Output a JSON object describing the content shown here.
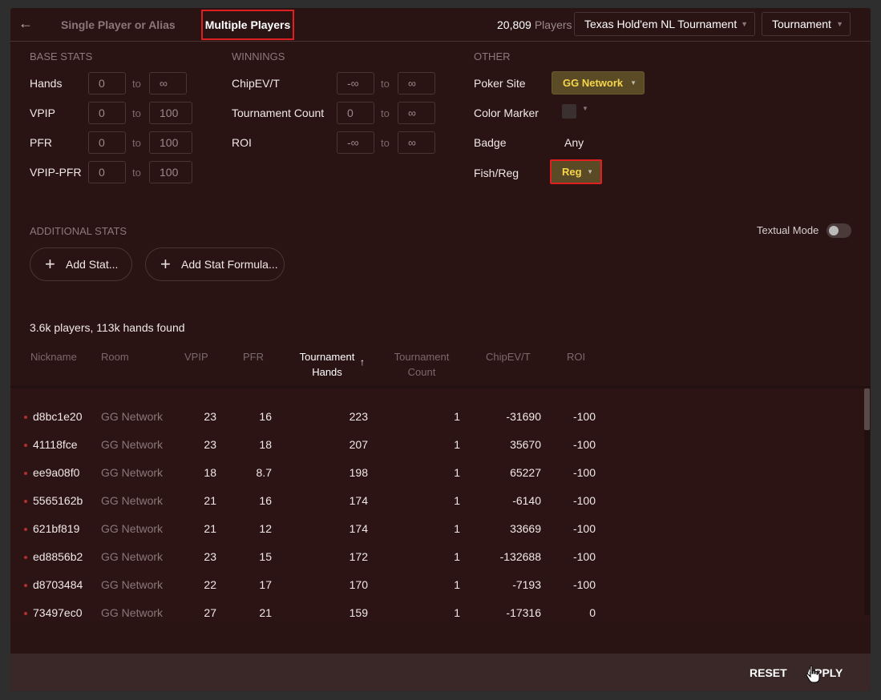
{
  "header": {
    "back_icon": "arrow-left-icon",
    "tab_single": "Single Player or Alias",
    "tab_multiple": "Multiple Players",
    "players_count": "20,809",
    "players_label": "Players",
    "game_type": "Texas Hold'em NL Tournament",
    "mode": "Tournament"
  },
  "base_stats": {
    "title": "BASE STATS",
    "rows": [
      {
        "label": "Hands",
        "from": "0",
        "to": "∞"
      },
      {
        "label": "VPIP",
        "from": "0",
        "to": "100"
      },
      {
        "label": "PFR",
        "from": "0",
        "to": "100"
      },
      {
        "label": "VPIP-PFR",
        "from": "0",
        "to": "100"
      }
    ]
  },
  "winnings": {
    "title": "WINNINGS",
    "rows": [
      {
        "label": "ChipEV/T",
        "from": "-∞",
        "to": "∞"
      },
      {
        "label": "Tournament Count",
        "from": "0",
        "to": "∞"
      },
      {
        "label": "ROI",
        "from": "-∞",
        "to": "∞"
      }
    ]
  },
  "to_label": "to",
  "other": {
    "title": "OTHER",
    "poker_site_label": "Poker Site",
    "poker_site_value": "GG Network",
    "color_marker_label": "Color Marker",
    "badge_label": "Badge",
    "badge_value": "Any",
    "fish_reg_label": "Fish/Reg",
    "fish_reg_value": "Reg"
  },
  "additional": {
    "title": "ADDITIONAL STATS",
    "textual_mode_label": "Textual Mode",
    "textual_mode_on": false,
    "add_stat": "Add Stat...",
    "add_formula": "Add Stat Formula..."
  },
  "results": {
    "found_text": "3.6k players, 113k hands found",
    "columns": {
      "nickname": "Nickname",
      "room": "Room",
      "vpip": "VPIP",
      "pfr": "PFR",
      "hands_line1": "Tournament",
      "hands_line2": "Hands",
      "count_line1": "Tournament",
      "count_line2": "Count",
      "chipev": "ChipEV/T",
      "roi": "ROI"
    },
    "rows": [
      {
        "nick": "d8bc1e20",
        "room": "GG Network",
        "vpip": "23",
        "pfr": "16",
        "hands": "223",
        "count": "1",
        "chipev": "-31690",
        "roi": "-100"
      },
      {
        "nick": "41118fce",
        "room": "GG Network",
        "vpip": "23",
        "pfr": "18",
        "hands": "207",
        "count": "1",
        "chipev": "35670",
        "roi": "-100"
      },
      {
        "nick": "ee9a08f0",
        "room": "GG Network",
        "vpip": "18",
        "pfr": "8.7",
        "hands": "198",
        "count": "1",
        "chipev": "65227",
        "roi": "-100"
      },
      {
        "nick": "5565162b",
        "room": "GG Network",
        "vpip": "21",
        "pfr": "16",
        "hands": "174",
        "count": "1",
        "chipev": "-6140",
        "roi": "-100"
      },
      {
        "nick": "621bf819",
        "room": "GG Network",
        "vpip": "21",
        "pfr": "12",
        "hands": "174",
        "count": "1",
        "chipev": "33669",
        "roi": "-100"
      },
      {
        "nick": "ed8856b2",
        "room": "GG Network",
        "vpip": "23",
        "pfr": "15",
        "hands": "172",
        "count": "1",
        "chipev": "-132688",
        "roi": "-100"
      },
      {
        "nick": "d8703484",
        "room": "GG Network",
        "vpip": "22",
        "pfr": "17",
        "hands": "170",
        "count": "1",
        "chipev": "-7193",
        "roi": "-100"
      },
      {
        "nick": "73497ec0",
        "room": "GG Network",
        "vpip": "27",
        "pfr": "21",
        "hands": "159",
        "count": "1",
        "chipev": "-17316",
        "roi": "0"
      }
    ]
  },
  "footer": {
    "reset": "RESET",
    "apply": "APPLY"
  }
}
